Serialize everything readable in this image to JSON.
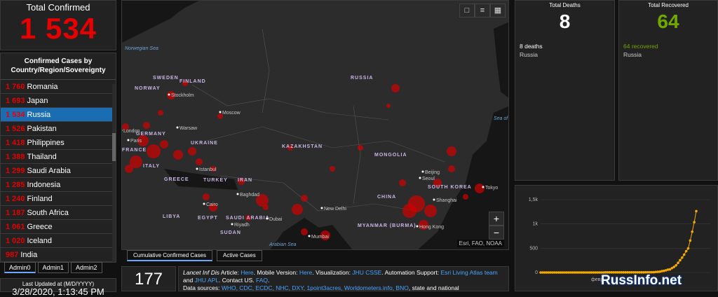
{
  "total_confirmed": {
    "title": "Total Confirmed",
    "value": "1 534"
  },
  "list": {
    "header": "Confirmed Cases by Country/Region/Sovereignty",
    "items": [
      {
        "count": "1 760",
        "name": "Romania"
      },
      {
        "count": "1 693",
        "name": "Japan"
      },
      {
        "count": "1 534",
        "name": "Russia",
        "selected": true
      },
      {
        "count": "1 526",
        "name": "Pakistan"
      },
      {
        "count": "1 418",
        "name": "Philippines"
      },
      {
        "count": "1 388",
        "name": "Thailand"
      },
      {
        "count": "1 299",
        "name": "Saudi Arabia"
      },
      {
        "count": "1 285",
        "name": "Indonesia"
      },
      {
        "count": "1 240",
        "name": "Finland"
      },
      {
        "count": "1 187",
        "name": "South Africa"
      },
      {
        "count": "1 061",
        "name": "Greece"
      },
      {
        "count": "1 020",
        "name": "Iceland"
      },
      {
        "count": "987",
        "name": "India"
      }
    ]
  },
  "admin_tabs": [
    "Admin0",
    "Admin1",
    "Admin2"
  ],
  "last_updated": {
    "label": "Last Updated at (M/D/YYYY)",
    "value": "3/28/2020, 1:13:45 PM"
  },
  "map": {
    "seas": [
      "Norwegian Sea",
      "Sea of Okhotsk",
      "Arabian Sea"
    ],
    "countries": [
      "SWEDEN",
      "FINLAND",
      "NORWAY",
      "RUSSIA",
      "UKRAINE",
      "KAZAKHSTAN",
      "MONGOLIA",
      "CHINA",
      "TURKEY",
      "IRAN",
      "LIBYA",
      "EGYPT",
      "SAUDI ARABIA",
      "SUDAN",
      "SOUTH KOREA",
      "MYANMAR (BURMA)",
      "GREECE",
      "ITALY",
      "GERMANY",
      "FRANCE"
    ],
    "cities": [
      "Stockholm",
      "Moscow",
      "London",
      "Paris",
      "Warsaw",
      "Istanbul",
      "Baghdad",
      "Cairo",
      "Riyadh",
      "Dubai",
      "New Delhi",
      "Mumbai",
      "Beijing",
      "Shanghai",
      "Hong Kong",
      "Tokyo",
      "Seoul"
    ],
    "tool_icons": [
      "bookmark-icon",
      "list-icon",
      "qr-icon"
    ],
    "zoom_in": "+",
    "zoom_out": "−",
    "attribution": "Esri, FAO, NOAA",
    "tabs": [
      "Cumulative Confirmed Cases",
      "Active Cases"
    ]
  },
  "countries_count": "177",
  "info": {
    "p1": "Lancet Inf Dis",
    "p2": " Article: ",
    "l1": "Here",
    "p3": ". Mobile Version: ",
    "l2": "Here",
    "p4": ". Visualization: ",
    "l3": "JHU CSSE",
    "p5": ". Automation Support: ",
    "l4": "Esri Living Atlas team",
    "p6": " and ",
    "l5": "JHU APL",
    "p7": ". Contact US. ",
    "l6": "FAQ",
    "p8": ".",
    "p9": "Data sources: ",
    "l7": "WHO, CDC, ECDC, NHC, DXY, 1point3acres, Worldometers.info, BNO",
    "p10": ", state and national"
  },
  "deaths": {
    "title": "Total Deaths",
    "value": "8",
    "sub": "8 deaths",
    "country": "Russia",
    "color": "#ffffff"
  },
  "recovered": {
    "title": "Total Recovered",
    "value": "64",
    "sub": "64 recovered",
    "country": "Russia",
    "color": "#70a800"
  },
  "chart_data": {
    "type": "line",
    "title": "",
    "ytick_labels": [
      "0",
      "500",
      "1k",
      "1,5k"
    ],
    "xtick_labels": [
      "февр."
    ],
    "ylim": [
      0,
      1500
    ],
    "series": [
      {
        "color": "#f5a800",
        "values": [
          0,
          0,
          0,
          0,
          0,
          0,
          0,
          0,
          0,
          0,
          0,
          0,
          0,
          0,
          0,
          0,
          0,
          0,
          0,
          0,
          0,
          0,
          0,
          0,
          0,
          0,
          0,
          0,
          0,
          0,
          0,
          0,
          2,
          2,
          2,
          2,
          2,
          2,
          2,
          2,
          2,
          2,
          2,
          2,
          3,
          3,
          3,
          3,
          3,
          3,
          3,
          3,
          4,
          4,
          4,
          5,
          6,
          10,
          13,
          17,
          28,
          34,
          45,
          59,
          63,
          90,
          114,
          147,
          199,
          253,
          306,
          367,
          438,
          495,
          658,
          840,
          1036,
          1264
        ]
      }
    ]
  },
  "watermark": "RussInfo.net"
}
